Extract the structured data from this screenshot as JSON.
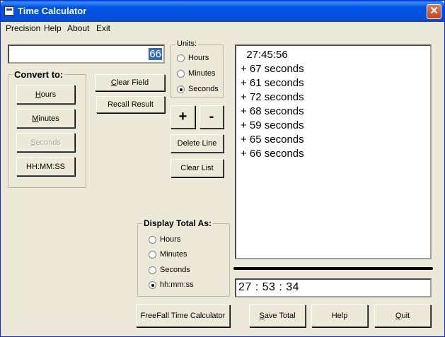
{
  "window": {
    "title": "Time Calculator",
    "close_glyph": "✕"
  },
  "menu": [
    "Precision",
    "Help",
    "About",
    "Exit"
  ],
  "input": {
    "value": "66"
  },
  "convert": {
    "legend": "Convert to:",
    "hours": {
      "label": "Hours",
      "mnemonic": "H",
      "rest": "ours"
    },
    "minutes": {
      "label": "Minutes",
      "mnemonic": "M",
      "rest": "inutes"
    },
    "seconds": {
      "label": "Seconds",
      "mnemonic": "S",
      "rest": "econds"
    },
    "hhmmss": "HH:MM:SS"
  },
  "buttons": {
    "clear_field": {
      "mnemonic": "C",
      "rest": "lear Field"
    },
    "recall_result": "Recall Result",
    "plus": "+",
    "minus": "-",
    "delete_line": "Delete Line",
    "clear_list": "Clear List",
    "freefall": "FreeFall Time Calculator",
    "save_total": {
      "mnemonic": "S",
      "rest": "ave Total"
    },
    "help": "Help",
    "quit": {
      "mnemonic": "Q",
      "rest": "uit"
    }
  },
  "units": {
    "legend": "Units:",
    "options": [
      {
        "label": "Hours",
        "selected": false
      },
      {
        "label": "Minutes",
        "selected": false
      },
      {
        "label": "Seconds",
        "selected": true
      }
    ]
  },
  "display_total": {
    "legend": "Display Total As:",
    "options": [
      {
        "label": "Hours",
        "selected": false
      },
      {
        "label": "Minutes",
        "selected": false
      },
      {
        "label": "Seconds",
        "selected": false
      },
      {
        "label": "hh:mm:ss",
        "selected": true
      }
    ]
  },
  "list": [
    "  27:45:56",
    "+ 67 seconds",
    "+ 61 seconds",
    "+ 72 seconds",
    "+ 68 seconds",
    "+ 59 seconds",
    "+ 65 seconds",
    "+ 66 seconds"
  ],
  "result": "27 : 53 : 34"
}
